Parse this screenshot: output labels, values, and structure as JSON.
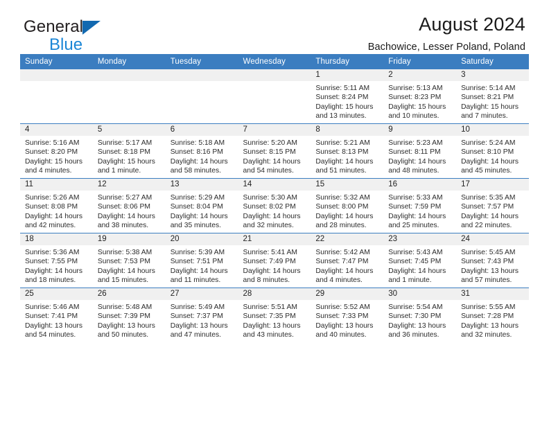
{
  "brand": {
    "name_part1": "General",
    "name_part2": "Blue",
    "triangle_color": "#1269b0",
    "blue_color": "#1b86d6"
  },
  "header": {
    "title": "August 2024",
    "subtitle": "Bachowice, Lesser Poland, Poland"
  },
  "theme": {
    "header_row_background": "#3b7dc0",
    "header_row_text": "#ffffff",
    "day_number_strip": "#f0f0f0",
    "grid_line": "#3b7dc0"
  },
  "weekday_headers": [
    "Sunday",
    "Monday",
    "Tuesday",
    "Wednesday",
    "Thursday",
    "Friday",
    "Saturday"
  ],
  "labels": {
    "sunrise_prefix": "Sunrise:",
    "sunset_prefix": "Sunset:",
    "daylight_prefix": "Daylight:"
  },
  "weeks": [
    [
      {
        "day": "",
        "empty": true
      },
      {
        "day": "",
        "empty": true
      },
      {
        "day": "",
        "empty": true
      },
      {
        "day": "",
        "empty": true
      },
      {
        "day": "1",
        "sunrise": "Sunrise: 5:11 AM",
        "sunset": "Sunset: 8:24 PM",
        "daylight_line1": "Daylight: 15 hours",
        "daylight_line2": "and 13 minutes."
      },
      {
        "day": "2",
        "sunrise": "Sunrise: 5:13 AM",
        "sunset": "Sunset: 8:23 PM",
        "daylight_line1": "Daylight: 15 hours",
        "daylight_line2": "and 10 minutes."
      },
      {
        "day": "3",
        "sunrise": "Sunrise: 5:14 AM",
        "sunset": "Sunset: 8:21 PM",
        "daylight_line1": "Daylight: 15 hours",
        "daylight_line2": "and 7 minutes."
      }
    ],
    [
      {
        "day": "4",
        "sunrise": "Sunrise: 5:16 AM",
        "sunset": "Sunset: 8:20 PM",
        "daylight_line1": "Daylight: 15 hours",
        "daylight_line2": "and 4 minutes."
      },
      {
        "day": "5",
        "sunrise": "Sunrise: 5:17 AM",
        "sunset": "Sunset: 8:18 PM",
        "daylight_line1": "Daylight: 15 hours",
        "daylight_line2": "and 1 minute."
      },
      {
        "day": "6",
        "sunrise": "Sunrise: 5:18 AM",
        "sunset": "Sunset: 8:16 PM",
        "daylight_line1": "Daylight: 14 hours",
        "daylight_line2": "and 58 minutes."
      },
      {
        "day": "7",
        "sunrise": "Sunrise: 5:20 AM",
        "sunset": "Sunset: 8:15 PM",
        "daylight_line1": "Daylight: 14 hours",
        "daylight_line2": "and 54 minutes."
      },
      {
        "day": "8",
        "sunrise": "Sunrise: 5:21 AM",
        "sunset": "Sunset: 8:13 PM",
        "daylight_line1": "Daylight: 14 hours",
        "daylight_line2": "and 51 minutes."
      },
      {
        "day": "9",
        "sunrise": "Sunrise: 5:23 AM",
        "sunset": "Sunset: 8:11 PM",
        "daylight_line1": "Daylight: 14 hours",
        "daylight_line2": "and 48 minutes."
      },
      {
        "day": "10",
        "sunrise": "Sunrise: 5:24 AM",
        "sunset": "Sunset: 8:10 PM",
        "daylight_line1": "Daylight: 14 hours",
        "daylight_line2": "and 45 minutes."
      }
    ],
    [
      {
        "day": "11",
        "sunrise": "Sunrise: 5:26 AM",
        "sunset": "Sunset: 8:08 PM",
        "daylight_line1": "Daylight: 14 hours",
        "daylight_line2": "and 42 minutes."
      },
      {
        "day": "12",
        "sunrise": "Sunrise: 5:27 AM",
        "sunset": "Sunset: 8:06 PM",
        "daylight_line1": "Daylight: 14 hours",
        "daylight_line2": "and 38 minutes."
      },
      {
        "day": "13",
        "sunrise": "Sunrise: 5:29 AM",
        "sunset": "Sunset: 8:04 PM",
        "daylight_line1": "Daylight: 14 hours",
        "daylight_line2": "and 35 minutes."
      },
      {
        "day": "14",
        "sunrise": "Sunrise: 5:30 AM",
        "sunset": "Sunset: 8:02 PM",
        "daylight_line1": "Daylight: 14 hours",
        "daylight_line2": "and 32 minutes."
      },
      {
        "day": "15",
        "sunrise": "Sunrise: 5:32 AM",
        "sunset": "Sunset: 8:00 PM",
        "daylight_line1": "Daylight: 14 hours",
        "daylight_line2": "and 28 minutes."
      },
      {
        "day": "16",
        "sunrise": "Sunrise: 5:33 AM",
        "sunset": "Sunset: 7:59 PM",
        "daylight_line1": "Daylight: 14 hours",
        "daylight_line2": "and 25 minutes."
      },
      {
        "day": "17",
        "sunrise": "Sunrise: 5:35 AM",
        "sunset": "Sunset: 7:57 PM",
        "daylight_line1": "Daylight: 14 hours",
        "daylight_line2": "and 22 minutes."
      }
    ],
    [
      {
        "day": "18",
        "sunrise": "Sunrise: 5:36 AM",
        "sunset": "Sunset: 7:55 PM",
        "daylight_line1": "Daylight: 14 hours",
        "daylight_line2": "and 18 minutes."
      },
      {
        "day": "19",
        "sunrise": "Sunrise: 5:38 AM",
        "sunset": "Sunset: 7:53 PM",
        "daylight_line1": "Daylight: 14 hours",
        "daylight_line2": "and 15 minutes."
      },
      {
        "day": "20",
        "sunrise": "Sunrise: 5:39 AM",
        "sunset": "Sunset: 7:51 PM",
        "daylight_line1": "Daylight: 14 hours",
        "daylight_line2": "and 11 minutes."
      },
      {
        "day": "21",
        "sunrise": "Sunrise: 5:41 AM",
        "sunset": "Sunset: 7:49 PM",
        "daylight_line1": "Daylight: 14 hours",
        "daylight_line2": "and 8 minutes."
      },
      {
        "day": "22",
        "sunrise": "Sunrise: 5:42 AM",
        "sunset": "Sunset: 7:47 PM",
        "daylight_line1": "Daylight: 14 hours",
        "daylight_line2": "and 4 minutes."
      },
      {
        "day": "23",
        "sunrise": "Sunrise: 5:43 AM",
        "sunset": "Sunset: 7:45 PM",
        "daylight_line1": "Daylight: 14 hours",
        "daylight_line2": "and 1 minute."
      },
      {
        "day": "24",
        "sunrise": "Sunrise: 5:45 AM",
        "sunset": "Sunset: 7:43 PM",
        "daylight_line1": "Daylight: 13 hours",
        "daylight_line2": "and 57 minutes."
      }
    ],
    [
      {
        "day": "25",
        "sunrise": "Sunrise: 5:46 AM",
        "sunset": "Sunset: 7:41 PM",
        "daylight_line1": "Daylight: 13 hours",
        "daylight_line2": "and 54 minutes."
      },
      {
        "day": "26",
        "sunrise": "Sunrise: 5:48 AM",
        "sunset": "Sunset: 7:39 PM",
        "daylight_line1": "Daylight: 13 hours",
        "daylight_line2": "and 50 minutes."
      },
      {
        "day": "27",
        "sunrise": "Sunrise: 5:49 AM",
        "sunset": "Sunset: 7:37 PM",
        "daylight_line1": "Daylight: 13 hours",
        "daylight_line2": "and 47 minutes."
      },
      {
        "day": "28",
        "sunrise": "Sunrise: 5:51 AM",
        "sunset": "Sunset: 7:35 PM",
        "daylight_line1": "Daylight: 13 hours",
        "daylight_line2": "and 43 minutes."
      },
      {
        "day": "29",
        "sunrise": "Sunrise: 5:52 AM",
        "sunset": "Sunset: 7:33 PM",
        "daylight_line1": "Daylight: 13 hours",
        "daylight_line2": "and 40 minutes."
      },
      {
        "day": "30",
        "sunrise": "Sunrise: 5:54 AM",
        "sunset": "Sunset: 7:30 PM",
        "daylight_line1": "Daylight: 13 hours",
        "daylight_line2": "and 36 minutes."
      },
      {
        "day": "31",
        "sunrise": "Sunrise: 5:55 AM",
        "sunset": "Sunset: 7:28 PM",
        "daylight_line1": "Daylight: 13 hours",
        "daylight_line2": "and 32 minutes."
      }
    ]
  ]
}
